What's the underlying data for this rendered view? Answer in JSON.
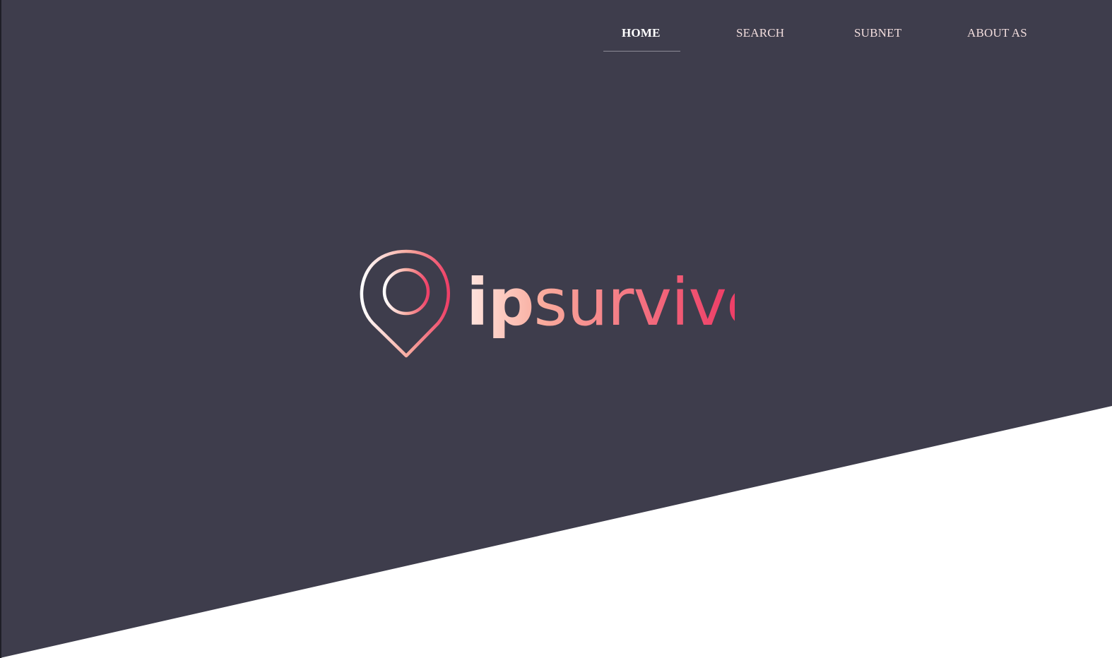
{
  "nav": {
    "items": [
      {
        "label": "HOME",
        "active": true
      },
      {
        "label": "SEARCH",
        "active": false
      },
      {
        "label": "SUBNET",
        "active": false
      },
      {
        "label": "ABOUT AS",
        "active": false
      }
    ]
  },
  "brand": {
    "name_part1": "ip",
    "name_part2": "survive",
    "logo_icon": "map-pin-icon"
  },
  "colors": {
    "hero_bg": "#3e3d4c",
    "page_bg": "#ffffff",
    "nav_text": "#f3dede",
    "gradient_start": "#ffffff",
    "gradient_mid": "#f9a79a",
    "gradient_end": "#ee3f67"
  }
}
